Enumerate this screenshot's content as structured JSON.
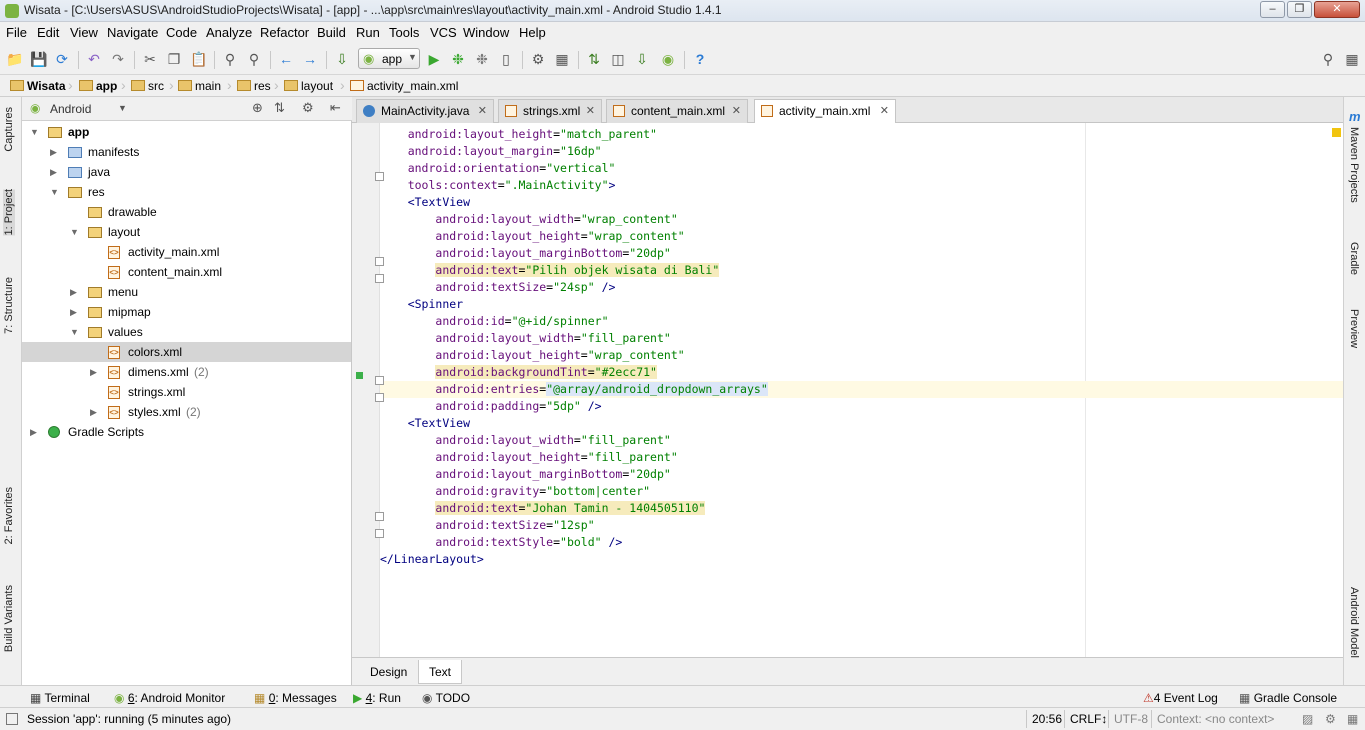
{
  "window": {
    "title": "Wisata - [C:\\Users\\ASUS\\AndroidStudioProjects\\Wisata] - [app] - ...\\app\\src\\main\\res\\layout\\activity_main.xml - Android Studio 1.4.1",
    "minimize": "–",
    "maximize": "❐",
    "close": "✕"
  },
  "menu": [
    "File",
    "Edit",
    "View",
    "Navigate",
    "Code",
    "Analyze",
    "Refactor",
    "Build",
    "Run",
    "Tools",
    "VCS",
    "Window",
    "Help"
  ],
  "toolbar": {
    "run_config": "app",
    "help": "?"
  },
  "breadcrumb": [
    "Wisata",
    "app",
    "src",
    "main",
    "res",
    "layout",
    "activity_main.xml"
  ],
  "left_tabs": [
    "Captures",
    "1: Project",
    "7: Structure",
    "2: Favorites",
    "Build Variants"
  ],
  "project": {
    "view_mode": "Android",
    "tree": [
      {
        "label": "app",
        "depth": 0,
        "expanded": true,
        "bold": true,
        "icon": "module"
      },
      {
        "label": "manifests",
        "depth": 1,
        "expanded": false,
        "icon": "folder-blue"
      },
      {
        "label": "java",
        "depth": 1,
        "expanded": false,
        "icon": "folder-blue"
      },
      {
        "label": "res",
        "depth": 1,
        "expanded": true,
        "icon": "folder-res"
      },
      {
        "label": "drawable",
        "depth": 2,
        "icon": "folder"
      },
      {
        "label": "layout",
        "depth": 2,
        "expanded": true,
        "icon": "folder"
      },
      {
        "label": "activity_main.xml",
        "depth": 3,
        "icon": "xml"
      },
      {
        "label": "content_main.xml",
        "depth": 3,
        "icon": "xml"
      },
      {
        "label": "menu",
        "depth": 2,
        "expanded": false,
        "icon": "folder"
      },
      {
        "label": "mipmap",
        "depth": 2,
        "expanded": false,
        "icon": "folder"
      },
      {
        "label": "values",
        "depth": 2,
        "expanded": true,
        "icon": "folder"
      },
      {
        "label": "colors.xml",
        "depth": 3,
        "icon": "xml",
        "selected": true
      },
      {
        "label": "dimens.xml",
        "count": "(2)",
        "depth": 3,
        "expanded": false,
        "icon": "xml"
      },
      {
        "label": "strings.xml",
        "depth": 3,
        "icon": "xml"
      },
      {
        "label": "styles.xml",
        "count": "(2)",
        "depth": 3,
        "expanded": false,
        "icon": "xml"
      },
      {
        "label": "Gradle Scripts",
        "depth": 0,
        "expanded": false,
        "icon": "gradle"
      }
    ]
  },
  "editor_tabs": [
    {
      "label": "MainActivity.java",
      "icon": "java"
    },
    {
      "label": "strings.xml",
      "icon": "xml"
    },
    {
      "label": "content_main.xml",
      "icon": "xml"
    },
    {
      "label": "activity_main.xml",
      "icon": "xml",
      "active": true
    }
  ],
  "code_lines": [
    {
      "indent": "    ",
      "attr": "android:layout_height",
      "val": "\"match_parent\""
    },
    {
      "indent": "    ",
      "attr": "android:layout_margin",
      "val": "\"16dp\""
    },
    {
      "indent": "    ",
      "attr": "android:orientation",
      "val": "\"vertical\""
    },
    {
      "indent": "    ",
      "attr": "tools:context",
      "val": "\".MainActivity\"",
      "tail": ">"
    },
    {
      "indent": "    ",
      "tag": "<TextView"
    },
    {
      "indent": "        ",
      "attr": "android:layout_width",
      "val": "\"wrap_content\""
    },
    {
      "indent": "        ",
      "attr": "android:layout_height",
      "val": "\"wrap_content\""
    },
    {
      "indent": "        ",
      "attr": "android:layout_marginBottom",
      "val": "\"20dp\""
    },
    {
      "indent": "        ",
      "attr": "android:text",
      "val": "\"Pilih objek wisata di Bali\"",
      "hl": true
    },
    {
      "indent": "        ",
      "attr": "android:textSize",
      "val": "\"24sp\"",
      "tail": " />"
    },
    {
      "indent": "    ",
      "tag": "<Spinner"
    },
    {
      "indent": "        ",
      "attr": "android:id",
      "val": "\"@+id/spinner\""
    },
    {
      "indent": "        ",
      "attr": "android:layout_width",
      "val": "\"fill_parent\""
    },
    {
      "indent": "        ",
      "attr": "android:layout_height",
      "val": "\"wrap_content\""
    },
    {
      "indent": "        ",
      "attr": "android:backgroundTint",
      "val": "\"#2ecc71\"",
      "hl": true
    },
    {
      "indent": "        ",
      "attr": "android:entries",
      "val": "\"@array/android_dropdown_arrays\"",
      "cur": true
    },
    {
      "indent": "        ",
      "attr": "android:padding",
      "val": "\"5dp\"",
      "tail": " />"
    },
    {
      "indent": "    ",
      "tag": "<TextView"
    },
    {
      "indent": "        ",
      "attr": "android:layout_width",
      "val": "\"fill_parent\""
    },
    {
      "indent": "        ",
      "attr": "android:layout_height",
      "val": "\"fill_parent\""
    },
    {
      "indent": "        ",
      "attr": "android:layout_marginBottom",
      "val": "\"20dp\""
    },
    {
      "indent": "        ",
      "attr": "android:gravity",
      "val": "\"bottom|center\""
    },
    {
      "indent": "        ",
      "attr": "android:text",
      "val": "\"Johan Tamin - 1404505110\"",
      "hl": true
    },
    {
      "indent": "        ",
      "attr": "android:textSize",
      "val": "\"12sp\""
    },
    {
      "indent": "        ",
      "attr": "android:textStyle",
      "val": "\"bold\"",
      "tail": " />"
    },
    {
      "indent": "",
      "tag": "</LinearLayout>"
    }
  ],
  "design_tabs": [
    "Design",
    "Text"
  ],
  "right_tabs": [
    "Maven Projects",
    "Gradle",
    "Preview",
    "Android Model"
  ],
  "bottom_tools": [
    {
      "key": "",
      "label": "Terminal"
    },
    {
      "key": "6",
      "label": ": Android Monitor"
    },
    {
      "key": "0",
      "label": ": Messages"
    },
    {
      "key": "4",
      "label": ": Run"
    },
    {
      "key": "",
      "label": "TODO"
    }
  ],
  "bottom_right": [
    {
      "key": "4",
      "label": " Event Log"
    },
    {
      "key": "",
      "label": "Gradle Console"
    }
  ],
  "status": {
    "message": "Session 'app': running (5 minutes ago)",
    "position": "20:56",
    "line_sep": "CRLF↕",
    "encoding": "UTF-8",
    "context": "Context: <no context>"
  },
  "colors": {
    "string_value": "#008000",
    "attr_name": "#660e7a",
    "tag": "#000080",
    "accent": "#4caf50"
  }
}
